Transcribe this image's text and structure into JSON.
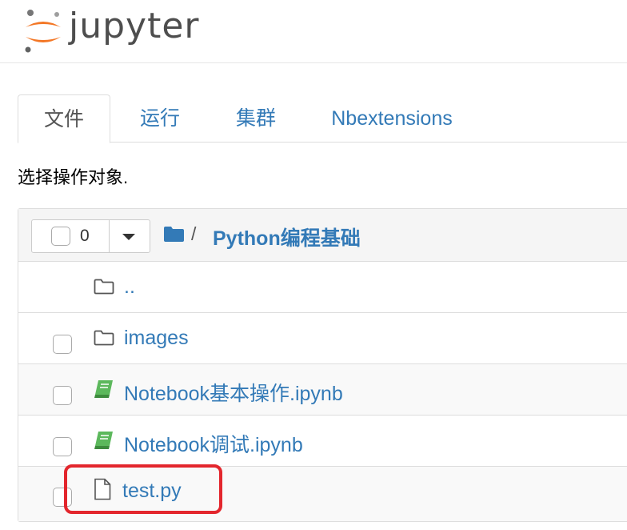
{
  "header": {
    "logo_text": "jupyter"
  },
  "tabs": [
    {
      "label": "文件",
      "active": true
    },
    {
      "label": "运行",
      "active": false
    },
    {
      "label": "集群",
      "active": false
    },
    {
      "label": "Nbextensions",
      "active": false
    }
  ],
  "hint": "选择操作对象.",
  "toolbar": {
    "selected_count": "0",
    "breadcrumb_sep": "/",
    "breadcrumb_folder": "Python编程基础"
  },
  "files": [
    {
      "name": "..",
      "icon": "folder-outline-icon",
      "has_checkbox": false
    },
    {
      "name": "images",
      "icon": "folder-outline-icon",
      "has_checkbox": true
    },
    {
      "name": "Notebook基本操作.ipynb",
      "icon": "notebook-book-icon",
      "has_checkbox": true
    },
    {
      "name": "Notebook调试.ipynb",
      "icon": "notebook-book-icon",
      "has_checkbox": true
    },
    {
      "name": "test.py",
      "icon": "file-icon",
      "has_checkbox": true
    }
  ],
  "colors": {
    "link": "#337ab7",
    "notebook_icon": "#5cb85c",
    "highlight": "#e3262d",
    "logo_orange": "#f37726"
  }
}
